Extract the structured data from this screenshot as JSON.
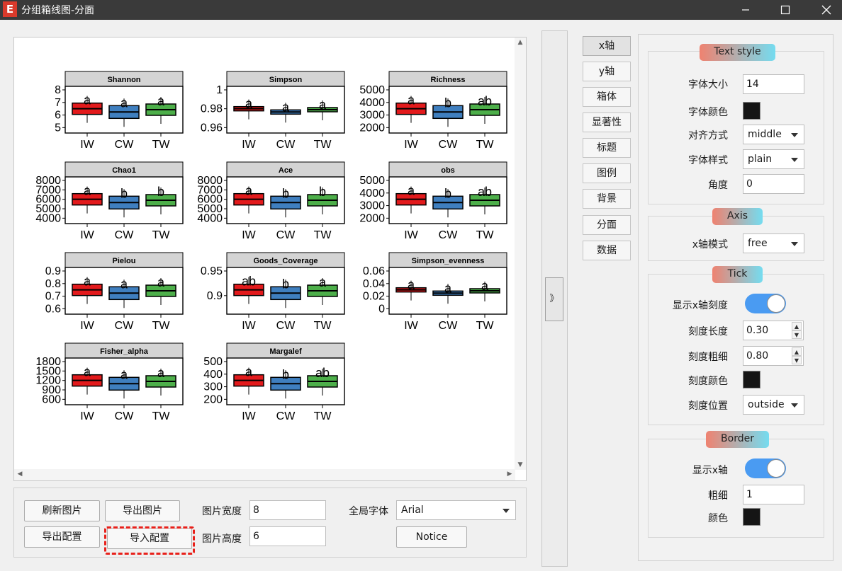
{
  "window": {
    "title": "分组箱线图-分面",
    "logo": "E"
  },
  "facet_panel": {
    "x_labels": [
      "IW",
      "CW",
      "TW"
    ],
    "group_colors": {
      "IW": "#e31a1c",
      "CW": "#3f7fbf",
      "TW": "#4daf4a"
    },
    "panels": [
      {
        "title": "Shannon",
        "y_ticks": [
          "8",
          "7",
          "6",
          "5"
        ],
        "letters": [
          "a",
          "a",
          "a"
        ]
      },
      {
        "title": "Simpson",
        "y_ticks": [
          "1",
          "0.98",
          "0.96"
        ],
        "letters": [
          "a",
          "a",
          "a"
        ]
      },
      {
        "title": "Richness",
        "y_ticks": [
          "5000",
          "4000",
          "3000",
          "2000"
        ],
        "letters": [
          "a",
          "b",
          "ab"
        ]
      },
      {
        "title": "Chao1",
        "y_ticks": [
          "8000",
          "7000",
          "6000",
          "5000",
          "4000"
        ],
        "letters": [
          "a",
          "b",
          "b"
        ]
      },
      {
        "title": "Ace",
        "y_ticks": [
          "8000",
          "7000",
          "6000",
          "5000",
          "4000"
        ],
        "letters": [
          "a",
          "b",
          "b"
        ]
      },
      {
        "title": "obs",
        "y_ticks": [
          "5000",
          "4000",
          "3000",
          "2000"
        ],
        "letters": [
          "a",
          "b",
          "ab"
        ]
      },
      {
        "title": "Pielou",
        "y_ticks": [
          "0.9",
          "0.8",
          "0.7",
          "0.6"
        ],
        "letters": [
          "a",
          "a",
          "a"
        ]
      },
      {
        "title": "Goods_Coverage",
        "y_ticks": [
          "0.95",
          "0.9"
        ],
        "letters": [
          "ab",
          "b",
          "a"
        ]
      },
      {
        "title": "Simpson_evenness",
        "y_ticks": [
          "0.06",
          "0.04",
          "0.02",
          "0"
        ],
        "letters": [
          "a",
          "a",
          "a"
        ]
      },
      {
        "title": "Fisher_alpha",
        "y_ticks": [
          "1800",
          "1500",
          "1200",
          "900",
          "600"
        ],
        "letters": [
          "a",
          "a",
          "a"
        ]
      },
      {
        "title": "Margalef",
        "y_ticks": [
          "500",
          "400",
          "300",
          "200"
        ],
        "letters": [
          "a",
          "b",
          "ab"
        ]
      }
    ]
  },
  "bottom": {
    "refresh_label": "刷新图片",
    "export_image_label": "导出图片",
    "export_config_label": "导出配置",
    "import_config_label": "导入配置",
    "width_label": "图片宽度",
    "width_value": "8",
    "height_label": "图片高度",
    "height_value": "6",
    "font_label": "全局字体",
    "font_value": "Arial",
    "notice_label": "Notice"
  },
  "collapse_label": "》",
  "tabs": [
    "x轴",
    "y轴",
    "箱体",
    "显著性",
    "标题",
    "图例",
    "背景",
    "分面",
    "数据"
  ],
  "active_tab": "x轴",
  "text_style": {
    "header": "Text style",
    "size_label": "字体大小",
    "size_value": "14",
    "color_label": "字体颜色",
    "align_label": "对齐方式",
    "align_value": "middle",
    "style_label": "字体样式",
    "style_value": "plain",
    "angle_label": "角度",
    "angle_value": "0"
  },
  "axis": {
    "header": "Axis",
    "mode_label": "x轴模式",
    "mode_value": "free"
  },
  "tick": {
    "header": "Tick",
    "show_label": "显示x轴刻度",
    "show_on": true,
    "length_label": "刻度长度",
    "length_value": "0.30",
    "width_label": "刻度粗细",
    "width_value": "0.80",
    "color_label": "刻度颜色",
    "pos_label": "刻度位置",
    "pos_value": "outside"
  },
  "border": {
    "header": "Border",
    "show_label": "显示x轴",
    "show_on": true,
    "width_label": "粗细",
    "width_value": "1",
    "color_label": "颜色"
  },
  "colors": {
    "swatch": "#151515",
    "toggle_on": "#4a9bf2",
    "highlight": "#e8201a"
  }
}
